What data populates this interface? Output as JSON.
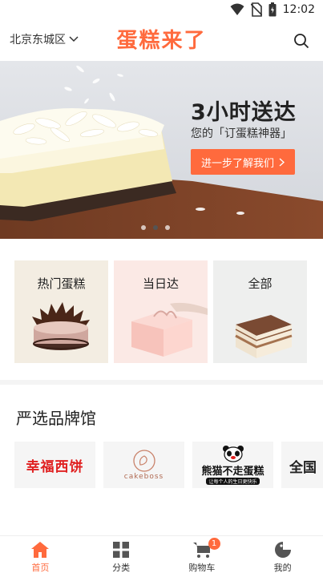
{
  "status_bar": {
    "time": "12:02"
  },
  "header": {
    "city": "北京东城区",
    "brand": "蛋糕来了"
  },
  "banner": {
    "title": "3小时送达",
    "subtitle": "您的「订蛋糕神器」",
    "cta_label": "进一步了解我们",
    "slide_count": 3,
    "active_slide": 1
  },
  "categories": [
    {
      "label": "热门蛋糕",
      "bg": "#f3ede2"
    },
    {
      "label": "当日达",
      "bg": "#fbe9e5"
    },
    {
      "label": "全部",
      "bg": "#eeefee"
    }
  ],
  "brand_section": {
    "title": "严选品牌馆",
    "brands": [
      {
        "name": "幸福西饼"
      },
      {
        "name": "cakeboss"
      },
      {
        "name": "熊猫不走蛋糕",
        "tagline": "让每个人的生日更快乐"
      },
      {
        "name": "全国"
      }
    ]
  },
  "tabbar": {
    "items": [
      {
        "label": "首页",
        "active": true
      },
      {
        "label": "分类"
      },
      {
        "label": "购物车",
        "badge": "1"
      },
      {
        "label": "我的"
      }
    ]
  },
  "colors": {
    "accent": "#ff6a3d"
  }
}
